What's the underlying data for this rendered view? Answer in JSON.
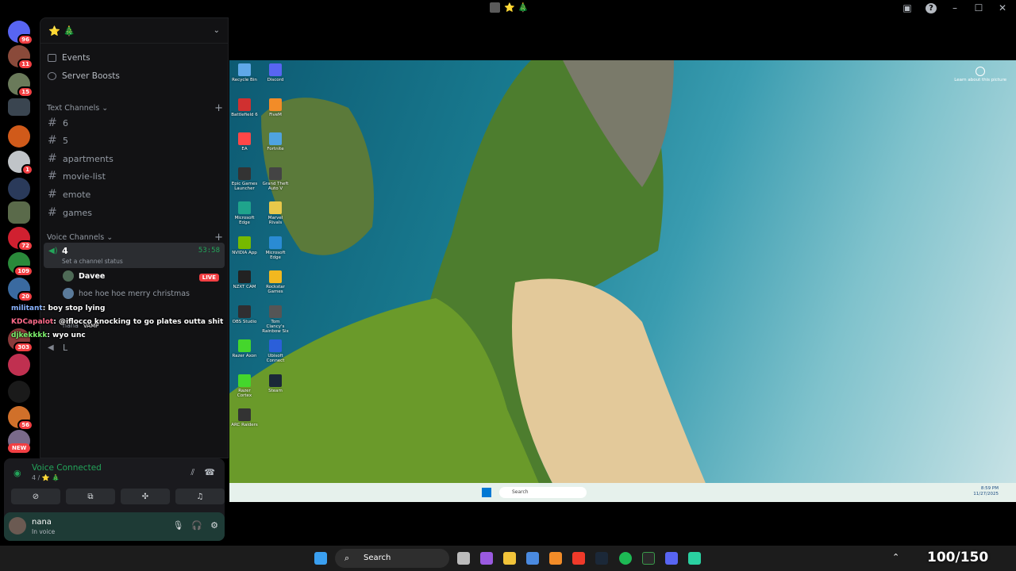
{
  "window": {
    "title_emoji": "⭐ 🎄"
  },
  "sidebar": {
    "server_name": "⭐ 🎄",
    "events_label": "Events",
    "boosts_label": "Server Boosts",
    "text_category": "Text Channels",
    "text_channels": [
      "6",
      "5",
      "apartments",
      "movie-list",
      "emote",
      "games"
    ],
    "voice_category": "Voice Channels",
    "voice_channel": {
      "name": "4",
      "time": "53:58",
      "status": "Set a channel status"
    },
    "voice_users": [
      {
        "name": "Davee",
        "live": "LIVE"
      },
      {
        "name": "hoe hoe hoe merry christmas"
      },
      {
        "name": "nana",
        "tag": "VAMP"
      }
    ],
    "second_voice": "L"
  },
  "rail_badges": [
    "96",
    "11",
    "15",
    "1",
    "72",
    "109",
    "20",
    "303",
    "56",
    "NEW"
  ],
  "chat_overlay": [
    {
      "user": "militant",
      "text": ": boy stop lying"
    },
    {
      "user": "KDCapalot",
      "text": ": @iflocco knocking to go plates outta shit"
    },
    {
      "user": "djkekkkk",
      "text": ": wyo unc"
    }
  ],
  "voice_panel": {
    "title": "Voice Connected",
    "subtitle": "4 / ⭐ 🎄"
  },
  "user": {
    "name": "nana",
    "status": "In voice"
  },
  "stream": {
    "desktop_icons": [
      {
        "label": "Recycle Bin",
        "color": "#5fa8e8"
      },
      {
        "label": "Discord",
        "color": "#5865f2"
      },
      {
        "label": "Battlefield 6",
        "color": "#d03030"
      },
      {
        "label": "FiveM",
        "color": "#f28c28"
      },
      {
        "label": "EA",
        "color": "#ff4747"
      },
      {
        "label": "Fortnite",
        "color": "#4fa3e0"
      },
      {
        "label": "Epic Games Launcher",
        "color": "#333333"
      },
      {
        "label": "Grand Theft Auto V",
        "color": "#444444"
      },
      {
        "label": "Microsoft Edge",
        "color": "#1fa48c"
      },
      {
        "label": "Marvel Rivals",
        "color": "#e8c84a"
      },
      {
        "label": "NVIDIA App",
        "color": "#76b900"
      },
      {
        "label": "Microsoft Edge",
        "color": "#2a8bd4"
      },
      {
        "label": "NZXT CAM",
        "color": "#222222"
      },
      {
        "label": "Rockstar Games",
        "color": "#f2b81f"
      },
      {
        "label": "OBS Studio",
        "color": "#302e31"
      },
      {
        "label": "Tom Clancy's Rainbow Six",
        "color": "#555555"
      },
      {
        "label": "Razer Axon",
        "color": "#44d62c"
      },
      {
        "label": "Ubisoft Connect",
        "color": "#2b5fd9"
      },
      {
        "label": "Razer Cortex",
        "color": "#44d62c"
      },
      {
        "label": "Steam",
        "color": "#1b2838"
      },
      {
        "label": "ARC Raiders",
        "color": "#333333"
      }
    ],
    "learn_label": "Learn about this picture",
    "inner_search": "Search",
    "inner_time": "8:59 PM",
    "inner_date": "11/27/2025"
  },
  "taskbar": {
    "search_label": "Search",
    "score": "100/150"
  }
}
